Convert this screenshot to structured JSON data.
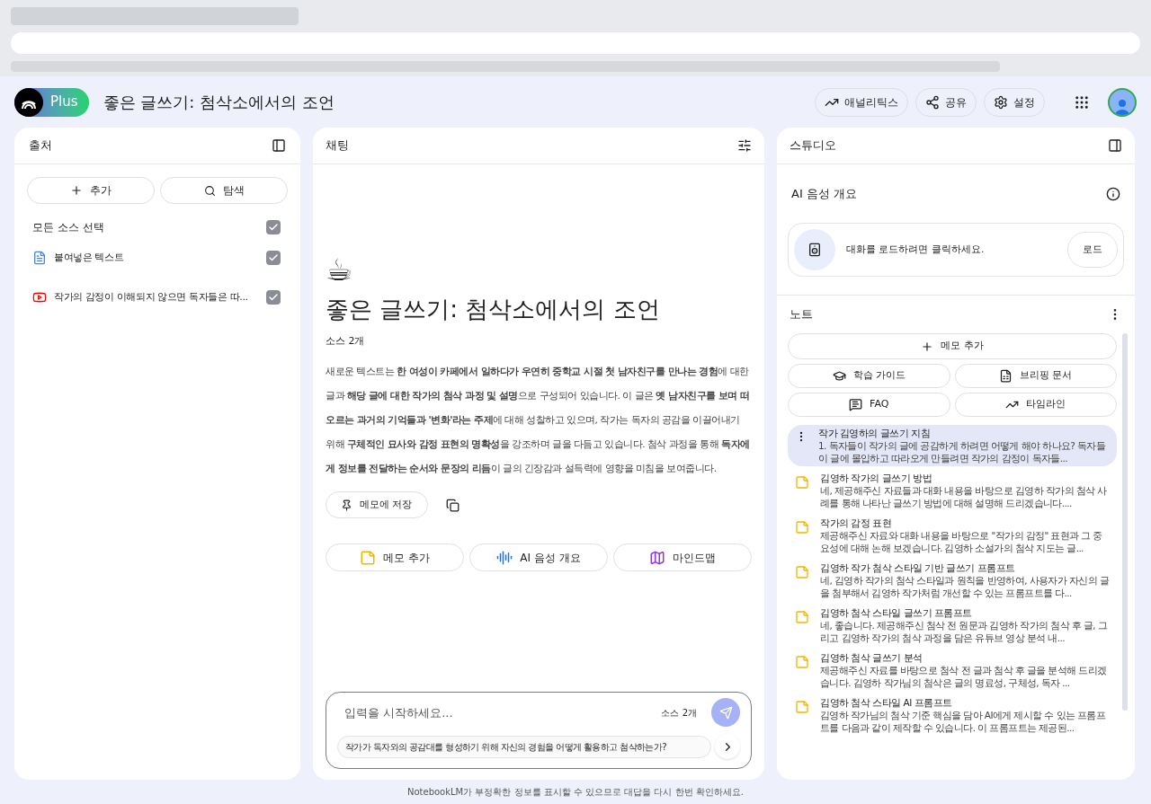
{
  "header": {
    "badge": "Plus",
    "title": "좋은 글쓰기: 첨삭소에서의 조언",
    "actions": [
      "애널리틱스",
      "공유",
      "설정"
    ]
  },
  "sources": {
    "title": "출처",
    "buttons": [
      "추가",
      "탐색"
    ],
    "select_all": {
      "label": "모든 소스 선택",
      "checked": true
    },
    "items": [
      {
        "kind": "text",
        "label": "붙여넣은 텍스트",
        "checked": true
      },
      {
        "kind": "video",
        "label": "작가의 감정이 이해되지 않으면 독자들은 따...",
        "checked": true
      }
    ]
  },
  "chat": {
    "title": "채팅",
    "emoji": "☕",
    "heading": "좋은 글쓰기: 첨삭소에서의 조언",
    "source_count": "소스 2개",
    "summary": "새로운 텍스트는 **한 여성이 카페에서 일하다가 우연히 중학교 시절 첫 남자친구를 만나는 경험**에 대한 글과 **해당 글에 대한 작가의 첨삭 과정 및 설명**으로 구성되어 있습니다. 이 글은 **옛 남자친구를 보며 떠오르는 과거의 기억들과 '변화'라는 주제**에 대해 성찰하고 있으며, 작가는 독자의 공감을 이끌어내기 위해 **구체적인 묘사와 감정 표현의 명확성**을 강조하며 글을 다듬고 있습니다. 첨삭 과정을 통해 **독자에게 정보를 전달하는 순서와 문장의 리듬**이 글의 긴장감과 설득력에 영향을 미침을 보여줍니다.",
    "save_button": "메모에 저장",
    "actions": [
      {
        "kind": "note",
        "label": "메모 추가"
      },
      {
        "kind": "audio",
        "label": "AI 음성 개요"
      },
      {
        "kind": "map",
        "label": "마인드맵"
      }
    ],
    "input": {
      "placeholder": "입력을 시작하세요...",
      "source_count": "소스 2개"
    },
    "suggestion": "작가가 독자와의 공감대를 형성하기 위해 자신의 경험을 어떻게 활용하고 첨삭하는가?"
  },
  "studio": {
    "title": "스튜디오",
    "audio": {
      "title": "AI 음성 개요",
      "message": "대화를 로드하려면 클릭하세요.",
      "button": "로드"
    },
    "notes_title": "노트",
    "add_note": "메모 추가",
    "tools": [
      {
        "kind": "guide",
        "label": "학습 가이드"
      },
      {
        "kind": "briefing",
        "label": "브리핑 문서"
      },
      {
        "kind": "faq",
        "label": "FAQ"
      },
      {
        "kind": "timeline",
        "label": "타임라인"
      }
    ],
    "notes": [
      {
        "title": "작가 김영하의 글쓰기 지침",
        "body": "1. 독자들이 작가의 글에 공감하게 하려면 어떻게 해야 하나요? 독자들이 글에 몰입하고 따라오게 만들려면 작가의 감정이 독자들...",
        "selected": true
      },
      {
        "title": "김영하 작가의 글쓰기 방법",
        "body": "네, 제공해주신 자료들과 대화 내용을 바탕으로 김영하 작가의 첨삭 사례를 통해 나타난 글쓰기 방법에 대해 설명해 드리겠습니다....",
        "selected": false
      },
      {
        "title": "작가의 감정 표현",
        "body": "제공해주신 자료와 대화 내용을 바탕으로 \"작가의 감정\" 표현과 그 중요성에 대해 논해 보겠습니다. 김영하 소설가의 첨삭 지도는 글...",
        "selected": false
      },
      {
        "title": "김영하 작가 첨삭 스타일 기반 글쓰기 프롬프트",
        "body": "네, 김영하 작가의 첨삭 스타일과 원칙을 반영하여, 사용자가 자신의 글을 첨부해서 김영하 작가처럼 개선할 수 있는 프롬프트를 다...",
        "selected": false
      },
      {
        "title": "김영하 첨삭 스타일 글쓰기 프롬프트",
        "body": "네, 좋습니다. 제공해주신 첨삭 전 원문과 김영하 작가의 첨삭 후 글, 그리고 김영하 작가의 첨삭 과정을 담은 유튜브 영상 분석 내...",
        "selected": false
      },
      {
        "title": "김영하 첨삭 글쓰기 분석",
        "body": "제공해주신 자료를 바탕으로 첨삭 전 글과 첨삭 후 글을 분석해 드리겠습니다. 김영하 작가님의 첨삭은 글의 명료성, 구체성, 독자 ...",
        "selected": false
      },
      {
        "title": "김영하 첨삭 스타일 AI 프롬프트",
        "body": "김영하 작가님의 첨삭 기준 핵심을 담아 AI에게 제시할 수 있는 프롬프트를 다음과 같이 제작할 수 있습니다. 이 프롬프트는 제공된...",
        "selected": false
      }
    ]
  },
  "footer": "NotebookLM가 부정확한 정보를 표시할 수 있으므로 대답을 다시 한번 확인하세요."
}
